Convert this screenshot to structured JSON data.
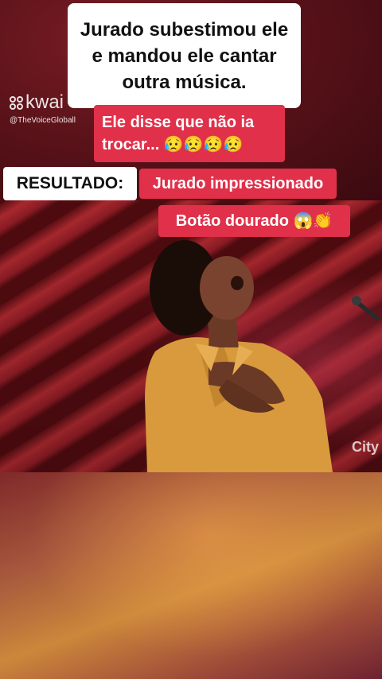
{
  "overlay": {
    "caption_main": "Jurado subestimou ele e mandou ele cantar outra música.",
    "pill_1_text": "Ele disse que não ia trocar...",
    "pill_1_emoji": "😥😥😥😥",
    "result_label": "RESULTADO:",
    "pill_2_text": "Jurado impressionado",
    "pill_3_text": "Botão dourado",
    "pill_3_emoji": "😱👏"
  },
  "watermark": {
    "brand": "kwai",
    "handle": "@TheVoiceGloball"
  },
  "video": {
    "corner_logo": "City"
  },
  "colors": {
    "pill_red": "#e0304a",
    "caption_bg": "#ffffff",
    "stage_red": "#c42f36",
    "shirt_mustard": "#d89a3c"
  }
}
